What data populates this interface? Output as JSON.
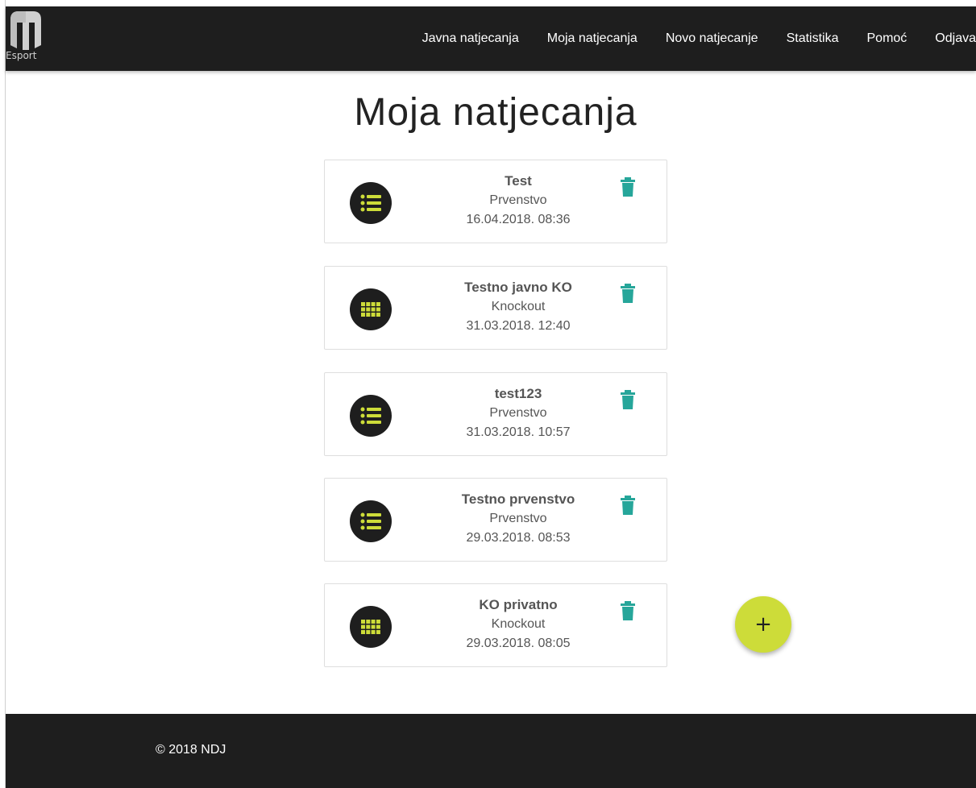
{
  "brand": {
    "logo_text": "Esport",
    "icon": "esport-logo-icon"
  },
  "nav": {
    "items": [
      {
        "label": "Javna natjecanja"
      },
      {
        "label": "Moja natjecanja"
      },
      {
        "label": "Novo natjecanje"
      },
      {
        "label": "Statistika"
      },
      {
        "label": "Pomoć"
      },
      {
        "label": "Odjava"
      }
    ]
  },
  "page": {
    "title": "Moja natjecanja"
  },
  "competitions": [
    {
      "name": "Test",
      "type": "Prvenstvo",
      "date": "16.04.2018. 08:36",
      "icon": "list-icon"
    },
    {
      "name": "Testno javno KO",
      "type": "Knockout",
      "date": "31.03.2018. 12:40",
      "icon": "grid-icon"
    },
    {
      "name": "test123",
      "type": "Prvenstvo",
      "date": "31.03.2018. 10:57",
      "icon": "list-icon"
    },
    {
      "name": "Testno prvenstvo",
      "type": "Prvenstvo",
      "date": "29.03.2018. 08:53",
      "icon": "list-icon"
    },
    {
      "name": "KO privatno",
      "type": "Knockout",
      "date": "29.03.2018. 08:05",
      "icon": "grid-icon"
    }
  ],
  "fab": {
    "label": "+",
    "icon": "plus-icon"
  },
  "footer": {
    "text": "© 2018 NDJ"
  },
  "colors": {
    "navbar": "#1e1e1e",
    "accent": "#cddc39",
    "trash": "#26a69a",
    "text": "#555555"
  }
}
